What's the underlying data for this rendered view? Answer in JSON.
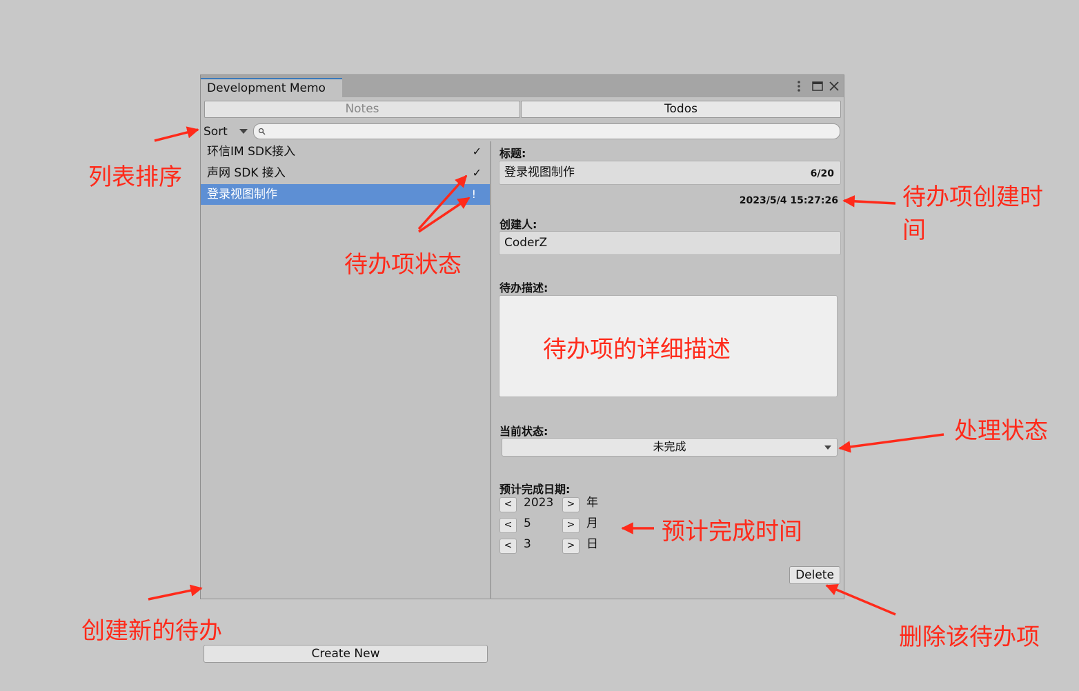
{
  "window": {
    "tab_title": "Development Memo",
    "menu_icon": "kebab-icon",
    "maximize_icon": "maximize-icon",
    "close_icon": "close-icon"
  },
  "tabs": {
    "notes": "Notes",
    "todos": "Todos"
  },
  "toolbar": {
    "sort_label": "Sort",
    "search_value": ""
  },
  "list": [
    {
      "label": "环信IM SDK接入",
      "status": "✓"
    },
    {
      "label": "声网 SDK 接入",
      "status": "✓"
    },
    {
      "label": "登录视图制作",
      "status": "!",
      "selected": true
    }
  ],
  "create_new": "Create New",
  "detail": {
    "title_label": "标题:",
    "title_value": "登录视图制作",
    "title_counter": "6/20",
    "created_time": "2023/5/4 15:27:26",
    "creator_label": "创建人:",
    "creator_value": "CoderZ",
    "desc_label": "待办描述:",
    "status_label": "当前状态:",
    "status_value": "未完成",
    "due_label": "预计完成日期:",
    "year": "2023",
    "year_unit": "年",
    "month": "5",
    "month_unit": "月",
    "day": "3",
    "day_unit": "日",
    "prev": "<",
    "next": ">",
    "delete": "Delete"
  },
  "annotations": {
    "sort": "列表排序",
    "status": "待办项状态",
    "created_time": "待办项创建时",
    "created_time_2": "间",
    "desc": "待办项的详细描述",
    "process": "处理状态",
    "due": "预计完成时间",
    "create": "创建新的待办",
    "delete": "删除该待办项"
  },
  "accent_color": "#ff2a1a",
  "selection_color": "#5d8fd4"
}
